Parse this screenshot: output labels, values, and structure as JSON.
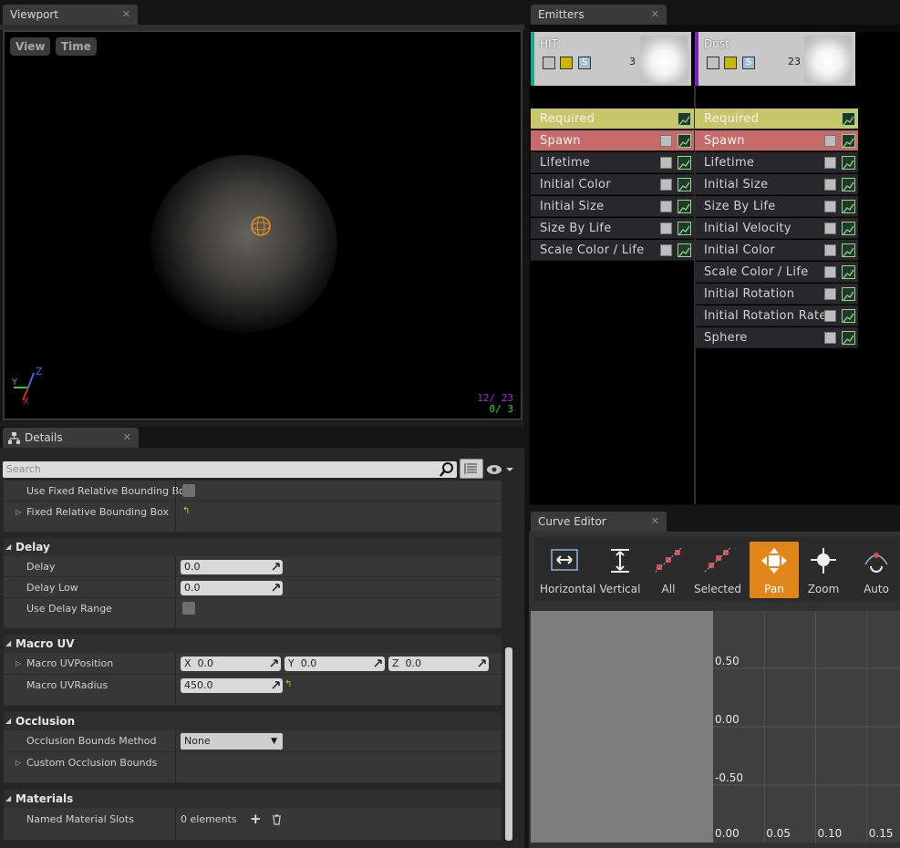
{
  "viewport": {
    "tab_label": "Viewport",
    "view_button": "View",
    "time_button": "Time",
    "axis_labels": {
      "z": "Z",
      "y": "Y",
      "x": "X"
    },
    "counts": [
      {
        "text": "12/  23",
        "color": "#9c2ad6"
      },
      {
        "text": "0/   3",
        "color": "#2ed62e"
      }
    ]
  },
  "emitters": {
    "tab_label": "Emitters",
    "columns": [
      {
        "name": "HIT",
        "count": "3",
        "accent": "#19a88b",
        "modules": [
          "Required",
          "Spawn",
          "Lifetime",
          "Initial Color",
          "Initial Size",
          "Size By Life",
          "Scale Color / Life"
        ]
      },
      {
        "name": "Dust",
        "count": "23",
        "accent": "#7a1fc0",
        "modules": [
          "Required",
          "Spawn",
          "Lifetime",
          "Initial Size",
          "Size By Life",
          "Initial Velocity",
          "Initial Color",
          "Scale Color / Life",
          "Initial Rotation",
          "Initial Rotation Rate",
          "Sphere"
        ]
      }
    ]
  },
  "details": {
    "tab_label": "Details",
    "search_placeholder": "Search",
    "rows_top": [
      {
        "label": "Use Fixed Relative Bounding Box"
      },
      {
        "label": "Fixed Relative Bounding Box"
      }
    ],
    "delay": {
      "title": "Delay",
      "delay_label": "Delay",
      "delay_value": "0.0",
      "delay_low_label": "Delay Low",
      "delay_low_value": "0.0",
      "use_delay_range_label": "Use Delay Range"
    },
    "macro_uv": {
      "title": "Macro UV",
      "position_label": "Macro UVPosition",
      "x_label": "X",
      "x_value": "0.0",
      "y_label": "Y",
      "y_value": "0.0",
      "z_label": "Z",
      "z_value": "0.0",
      "radius_label": "Macro UVRadius",
      "radius_value": "450.0"
    },
    "occlusion": {
      "title": "Occlusion",
      "method_label": "Occlusion Bounds Method",
      "method_value": "None",
      "custom_label": "Custom Occlusion Bounds"
    },
    "materials": {
      "title": "Materials",
      "slots_label": "Named Material Slots",
      "slots_value": "0 elements"
    }
  },
  "curve_editor": {
    "tab_label": "Curve Editor",
    "buttons": [
      "Horizontal",
      "Vertical",
      "All",
      "Selected",
      "Pan",
      "Zoom",
      "Auto"
    ],
    "active_button": "Pan",
    "y_ticks": [
      "0.50",
      "0.00",
      "-0.50"
    ],
    "x_ticks": [
      "0.00",
      "0.05",
      "0.10",
      "0.15"
    ]
  },
  "colors": {
    "accent_orange": "#e1861b",
    "required_yellow": "#c8c66a",
    "spawn_red": "#c76a6a"
  }
}
